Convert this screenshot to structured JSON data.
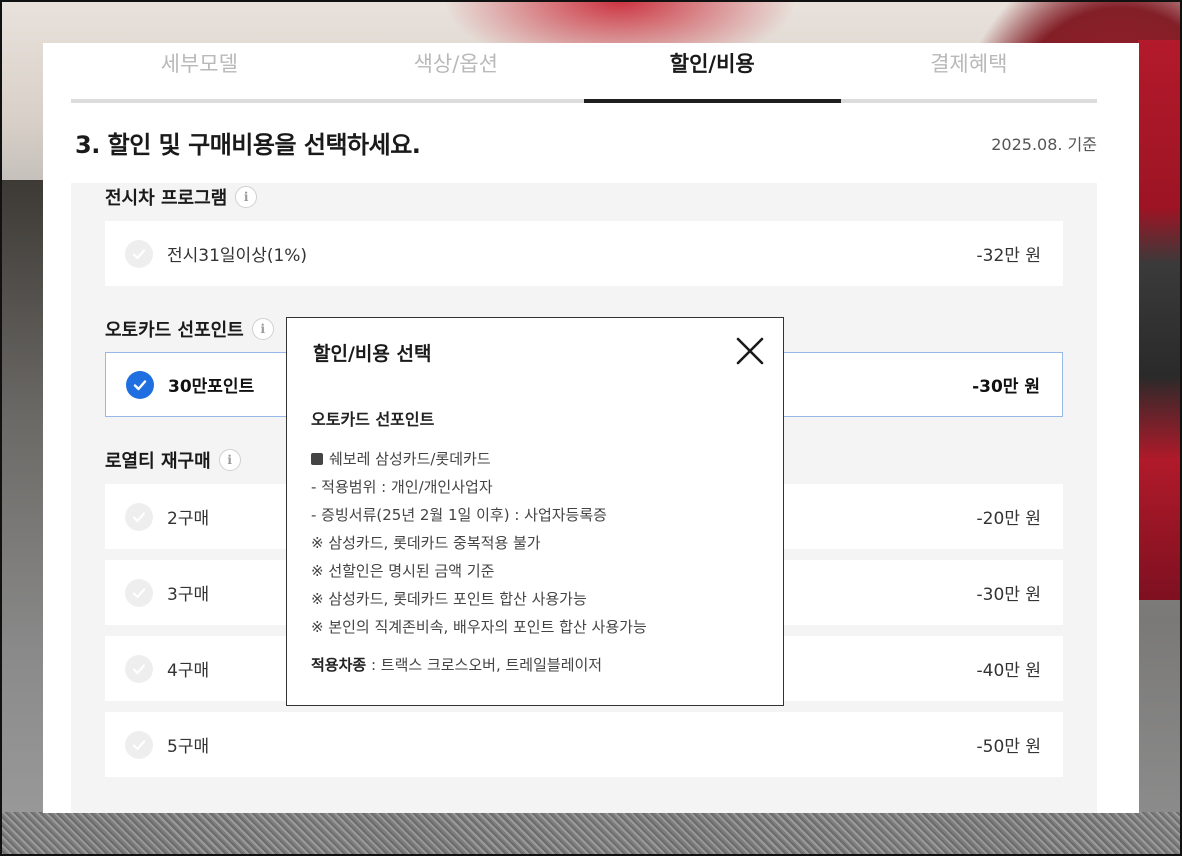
{
  "tabs": [
    {
      "label": "세부모델",
      "active": false
    },
    {
      "label": "색상/옵션",
      "active": false
    },
    {
      "label": "할인/비용",
      "active": true
    },
    {
      "label": "결제혜택",
      "active": false
    }
  ],
  "heading": "3. 할인 및 구매비용을 선택하세요.",
  "date_basis": "2025.08. 기준",
  "sections": {
    "display": {
      "title": "전시차 프로그램",
      "options": [
        {
          "label": "전시31일이상(1%)",
          "price": "-32만 원",
          "selected": false
        }
      ]
    },
    "autocard": {
      "title": "오토카드 선포인트",
      "options": [
        {
          "label": "30만포인트",
          "price": "-30만 원",
          "selected": true
        }
      ]
    },
    "loyalty": {
      "title": "로열티 재구매",
      "options": [
        {
          "label": "2구매",
          "price": "-20만 원",
          "selected": false
        },
        {
          "label": "3구매",
          "price": "-30만 원",
          "selected": false
        },
        {
          "label": "4구매",
          "price": "-40만 원",
          "selected": false
        },
        {
          "label": "5구매",
          "price": "-50만 원",
          "selected": false
        }
      ]
    }
  },
  "modal": {
    "title": "할인/비용 선택",
    "subtitle": "오토카드 선포인트",
    "lines": [
      "쉐보레 삼성카드/롯데카드",
      "- 적용범위 : 개인/개인사업자",
      "- 증빙서류(25년 2월 1일 이후) : 사업자등록증",
      "※ 삼성카드, 롯데카드 중복적용 불가",
      "※ 선할인은 명시된 금액 기준",
      "※ 삼성카드, 롯데카드 포인트 합산 사용가능",
      "※ 본인의 직계존비속, 배우자의 포인트 합산 사용가능"
    ],
    "footer_label": "적용차종",
    "footer_value": " : 트랙스 크로스오버, 트레일블레이저"
  },
  "colors": {
    "accent_check": "#1f6fe0",
    "selected_border": "#97b8e8",
    "active_tab_bar": "#1f1f1f"
  }
}
